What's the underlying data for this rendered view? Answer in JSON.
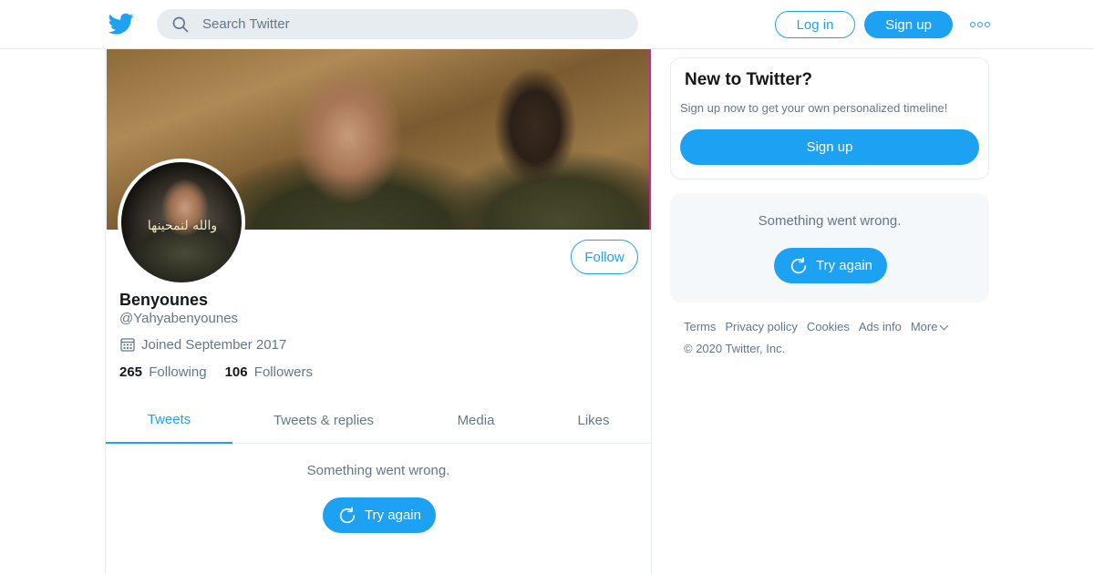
{
  "header": {
    "search_placeholder": "Search Twitter",
    "login_label": "Log in",
    "signup_label": "Sign up",
    "more_icon": "more-dots-icon"
  },
  "profile": {
    "name": "Benyounes",
    "handle": "@Yahyabenyounes",
    "joined": "Joined September 2017",
    "following_count": "265",
    "following_label": "Following",
    "followers_count": "106",
    "followers_label": "Followers",
    "follow_label": "Follow",
    "avatar_text": "والله لنمحينها"
  },
  "tabs": [
    {
      "label": "Tweets",
      "active": true
    },
    {
      "label": "Tweets & replies",
      "active": false
    },
    {
      "label": "Media",
      "active": false
    },
    {
      "label": "Likes",
      "active": false
    }
  ],
  "timeline": {
    "error_message": "Something went wrong.",
    "retry_label": "Try again"
  },
  "sidebar": {
    "new_title": "New to Twitter?",
    "new_subtitle": "Sign up now to get your own personalized timeline!",
    "signup_label": "Sign up",
    "error_message": "Something went wrong.",
    "retry_label": "Try again"
  },
  "footer": {
    "links": [
      "Terms",
      "Privacy policy",
      "Cookies",
      "Ads info",
      "More"
    ],
    "copyright": "© 2020 Twitter, Inc."
  },
  "colors": {
    "accent": "#1da1f2",
    "text_primary": "#14171a",
    "text_secondary": "#657786",
    "border": "#e6ecf0",
    "panel_bg": "#f5f8fa"
  }
}
